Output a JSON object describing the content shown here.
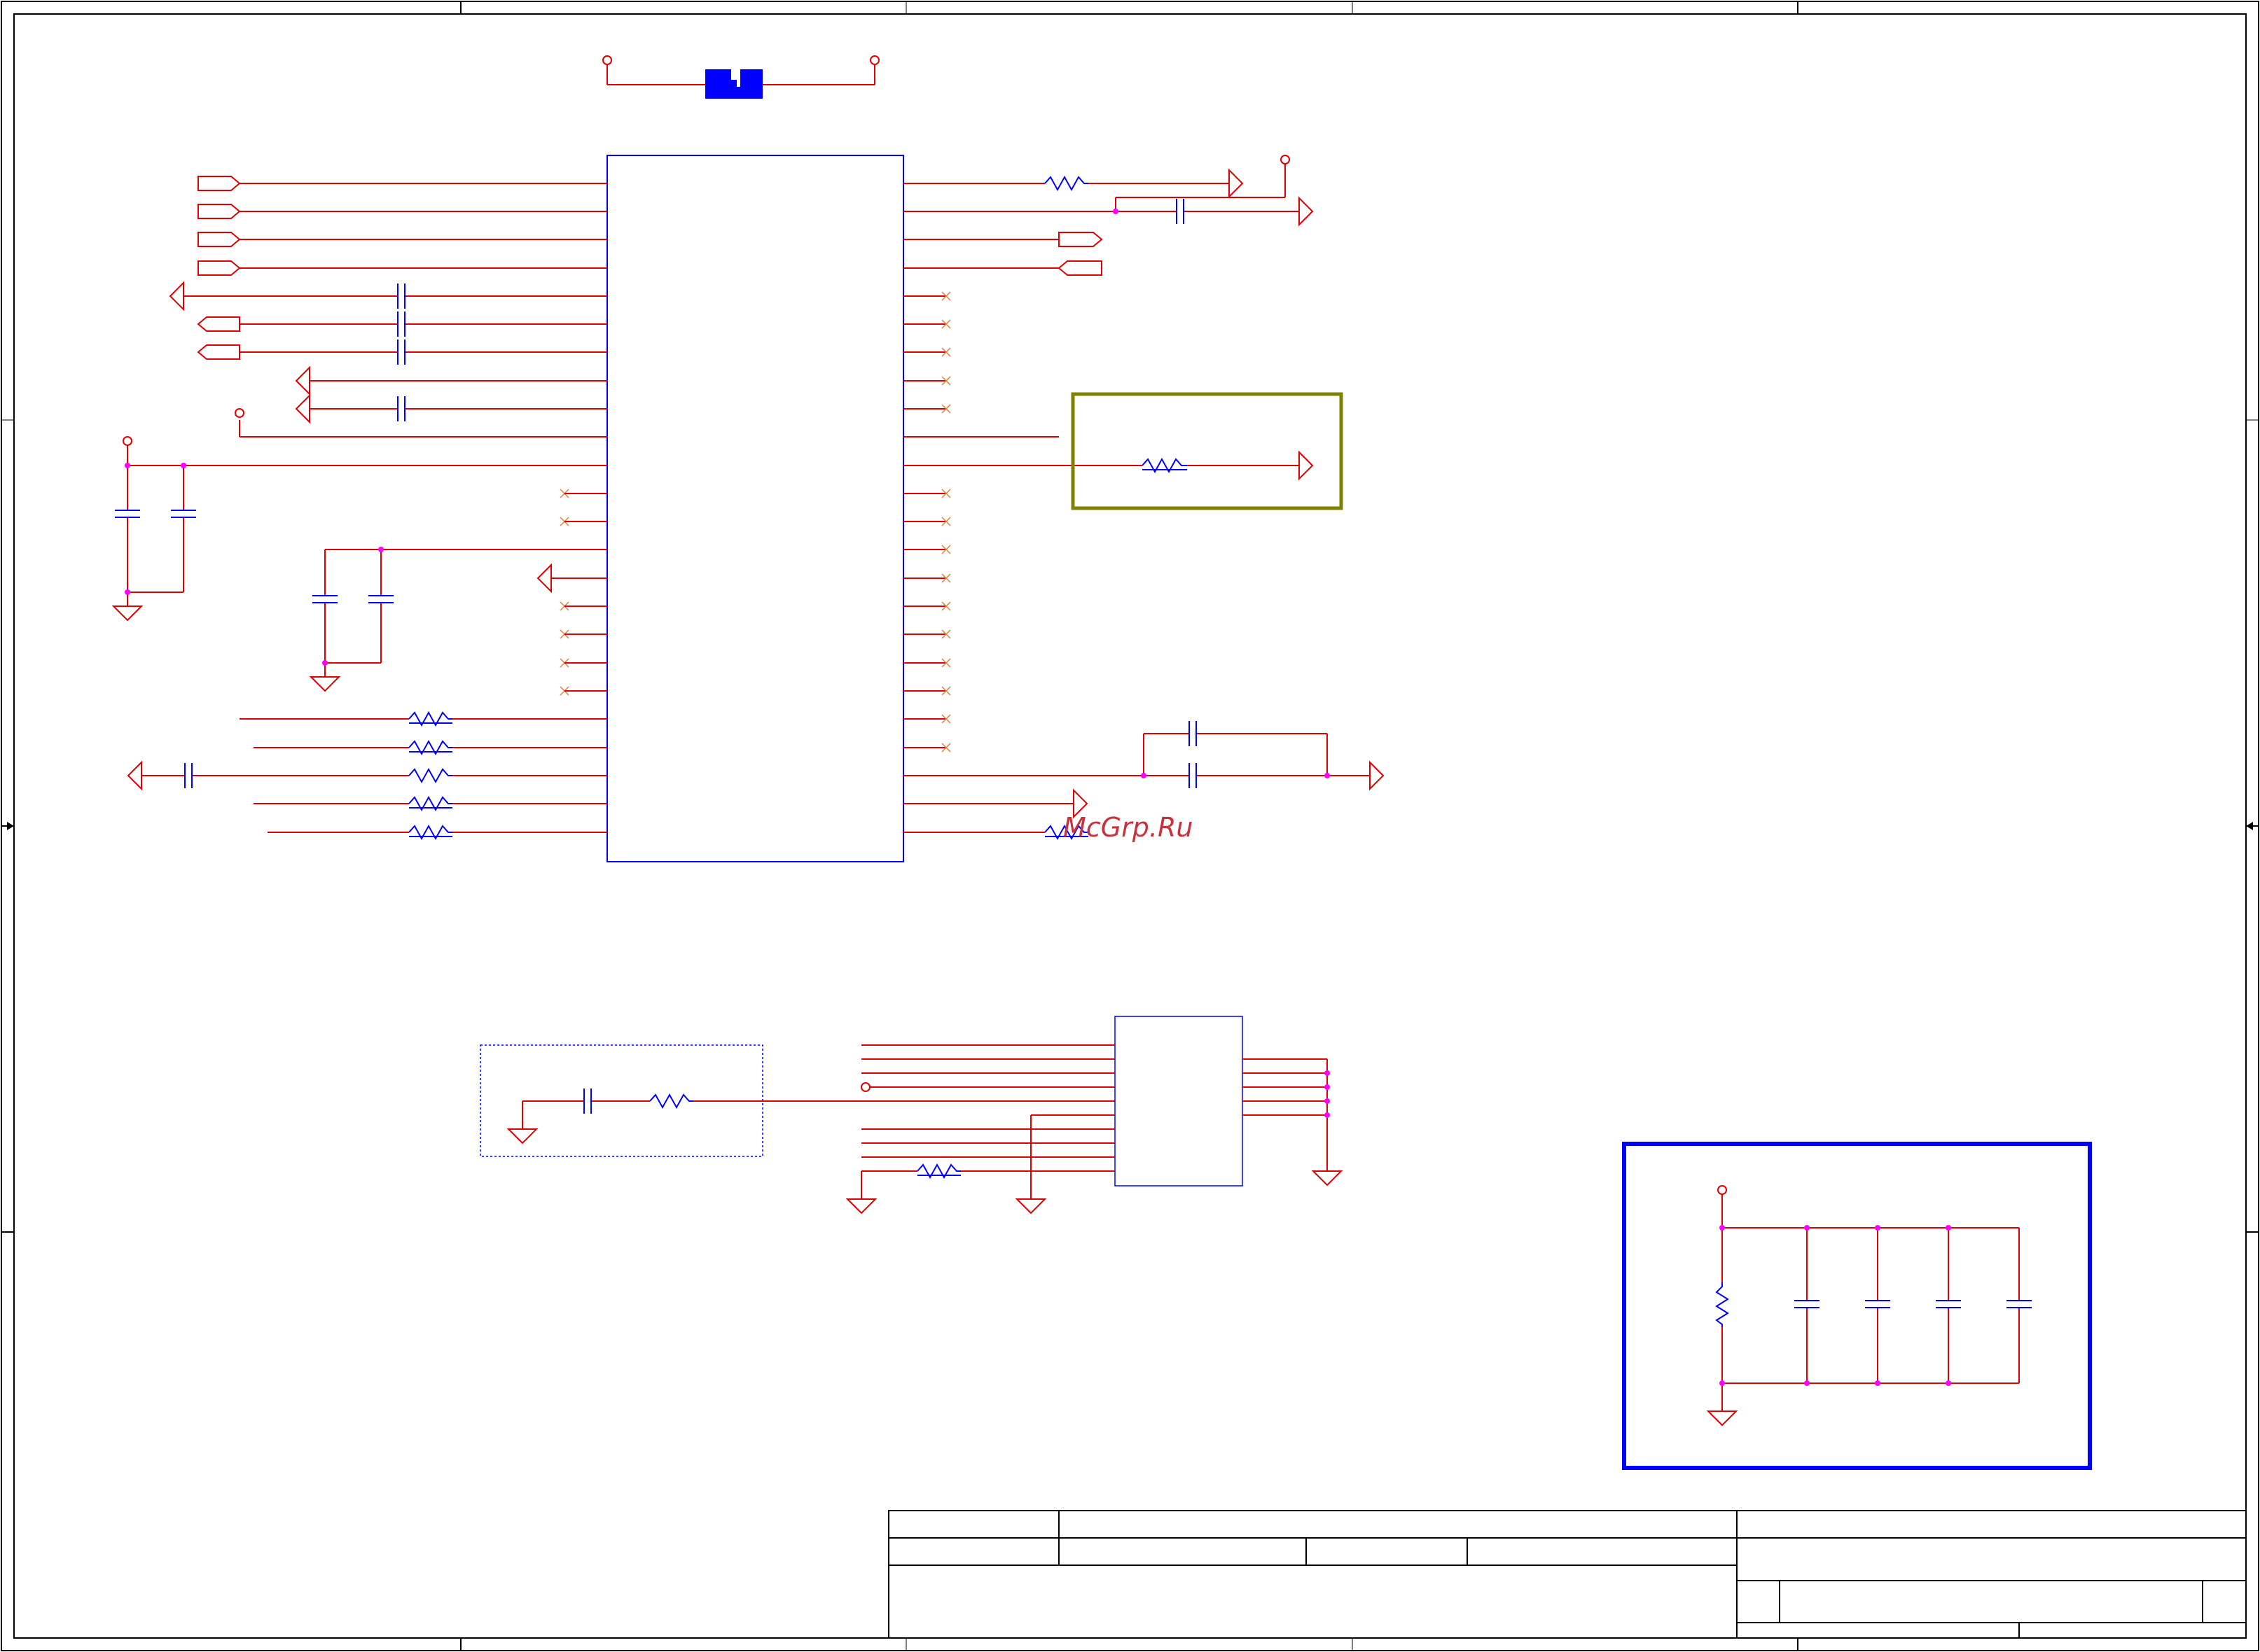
{
  "watermark": "McGrp.Ru",
  "colors": {
    "wire": "#e00000",
    "part": "#0000ff",
    "junction": "#ff00ff",
    "frame": "#000000",
    "highlight_box": "#808000",
    "selection_box": "#0000ff"
  },
  "icons": [
    "power-port-icon",
    "ground-icon",
    "offpage-connector-icon",
    "no-connect-icon",
    "crystal-icon"
  ]
}
